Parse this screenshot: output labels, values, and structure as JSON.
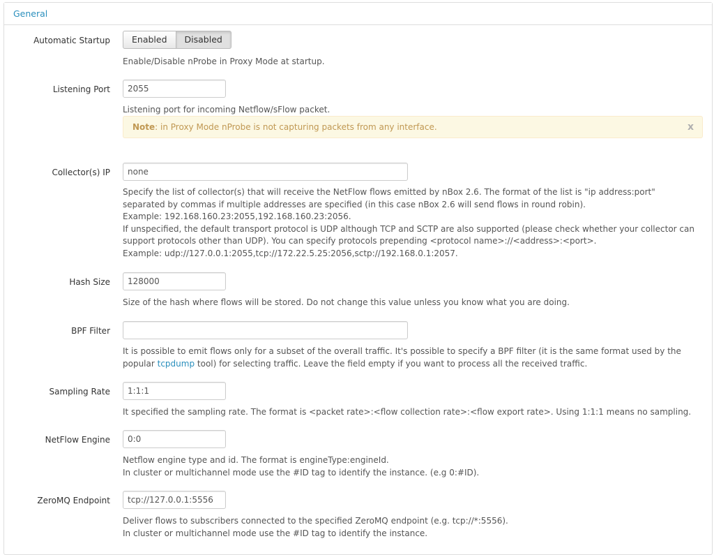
{
  "panel": {
    "title": "General"
  },
  "automatic_startup": {
    "label": "Automatic Startup",
    "enabled_label": "Enabled",
    "disabled_label": "Disabled",
    "selected": "Disabled",
    "help": "Enable/Disable nProbe in Proxy Mode at startup."
  },
  "listening_port": {
    "label": "Listening Port",
    "value": "2055",
    "help": "Listening port for incoming Netflow/sFlow packet.",
    "note_bold": "Note",
    "note_text": ": in Proxy Mode nProbe is not capturing packets from any interface.",
    "note_close": "x"
  },
  "collectors": {
    "label": "Collector(s) IP",
    "value": "none",
    "help_lines": [
      "Specify the list of collector(s) that will receive the NetFlow flows emitted by nBox 2.6. The format of the list is \"ip address:port\"",
      "separated by commas if multiple addresses are specified (in this case nBox 2.6 will send flows in round robin).",
      "Example: 192.168.160.23:2055,192.168.160.23:2056.",
      "If unspecified, the default transport protocol is UDP although TCP and SCTP are also supported (please check whether your collector can",
      "support protocols other than UDP). You can specify protocols prepending <protocol name>://<address>:<port>.",
      "Example: udp://127.0.0.1:2055,tcp://172.22.5.25:2056,sctp://192.168.0.1:2057."
    ]
  },
  "hash_size": {
    "label": "Hash Size",
    "value": "128000",
    "help": "Size of the hash where flows will be stored. Do not change this value unless you know what you are doing."
  },
  "bpf_filter": {
    "label": "BPF Filter",
    "value": "",
    "help_line1": "It is possible to emit flows only for a subset of the overall traffic. It's possible to specify a BPF filter (it is the same format used by the",
    "help_pre_link": "popular ",
    "help_link": "tcpdump",
    "help_post_link": " tool) for selecting traffic. Leave the field empty if you want to process all the received traffic."
  },
  "sampling_rate": {
    "label": "Sampling Rate",
    "value": "1:1:1",
    "help": "It specified the sampling rate. The format is <packet rate>:<flow collection rate>:<flow export rate>. Using 1:1:1 means no sampling."
  },
  "netflow_engine": {
    "label": "NetFlow Engine",
    "value": "0:0",
    "help_line1": "Netflow engine type and id. The format is engineType:engineId.",
    "help_line2": "In cluster or multichannel mode use the #ID tag to identify the instance. (e.g 0:#ID)."
  },
  "zeromq": {
    "label": "ZeroMQ Endpoint",
    "value": "tcp://127.0.0.1:5556",
    "help_line1": "Deliver flows to subscribers connected to the specified ZeroMQ endpoint (e.g. tcp://*:5556).",
    "help_line2": "In cluster or multichannel mode use the #ID tag to identify the instance."
  }
}
